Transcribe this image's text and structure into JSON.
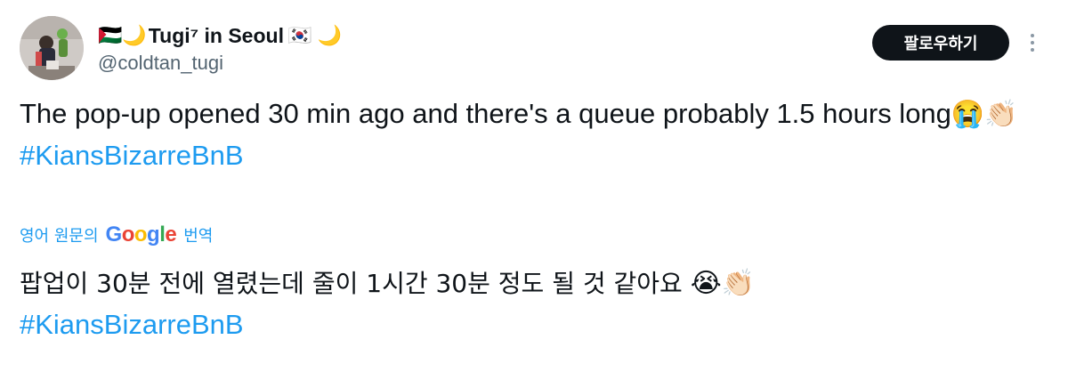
{
  "author": {
    "display_name": "Tugi⁷ in Seoul",
    "name_prefix_emoji": "🇵🇸🌙",
    "name_suffix_emoji": "🇰🇷 🌙",
    "handle": "@coldtan_tugi",
    "avatar_icon": "profile-avatar"
  },
  "follow_button": {
    "label": "팔로우하기"
  },
  "more_icon": "more-vertical-icon",
  "tweet": {
    "text_line": "The pop-up opened 30 min ago and there's a queue probably 1.5 hours long",
    "emojis": "😭👏🏻",
    "hashtag": "#KiansBizarreBnB"
  },
  "translation": {
    "prefix": "영어 원문의",
    "brand": "Google",
    "suffix": "번역",
    "text": "팝업이 30분 전에 열렸는데 줄이 1시간 30분 정도 될 것 같아요 ",
    "emojis": "😭👏🏻",
    "hashtag": "#KiansBizarreBnB"
  },
  "colors": {
    "link": "#1d9bf0",
    "text": "#0f1419",
    "secondary": "#536471",
    "button_bg": "#0f1419"
  }
}
